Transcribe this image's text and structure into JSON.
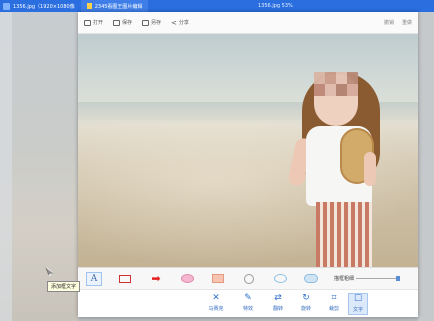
{
  "outer_window": {
    "tab1_title": "1356.jpg（1920×1080像",
    "tab2_title": "2345看图王图片编辑",
    "center_title": "1356.jpg 53%"
  },
  "viewer_toolbar": {
    "open": "打开",
    "save": "保存",
    "save_as": "另存",
    "share": "分享",
    "right_undo": "撤销",
    "right_redo": "重做"
  },
  "anno_tools": {
    "tooltip": "添加框文字",
    "font_size_label": "描框粗细"
  },
  "edit_toolbar": {
    "items": [
      {
        "icon": "✕",
        "label": "马赛克"
      },
      {
        "icon": "✎",
        "label": "特效"
      },
      {
        "icon": "⇄",
        "label": "翻转"
      },
      {
        "icon": "↻",
        "label": "旋转"
      },
      {
        "icon": "⌗",
        "label": "裁剪"
      },
      {
        "icon": "☐",
        "label": "文字"
      }
    ]
  },
  "colors": {
    "titlebar": "#2b6ee0",
    "accent": "#2f6fd1",
    "arrow_red": "#e52020"
  }
}
